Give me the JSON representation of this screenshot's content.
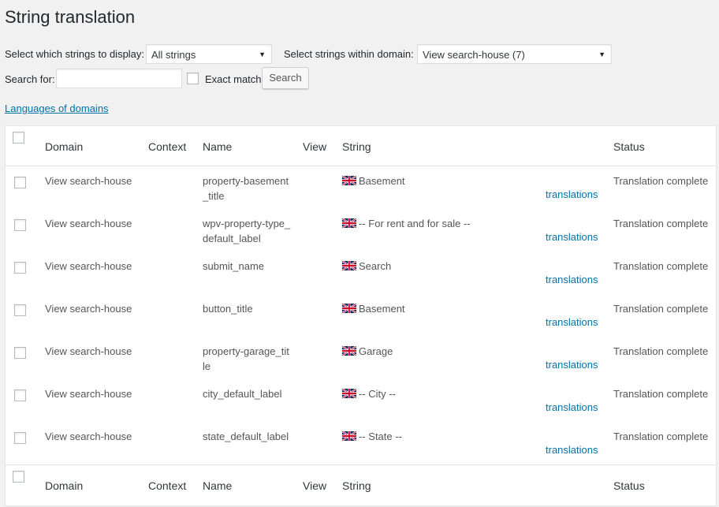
{
  "page": {
    "title": "String translation"
  },
  "filters": {
    "display_label": "Select which strings to display:",
    "display_value": "All strings",
    "domain_label": "Select strings within domain:",
    "domain_value": "View search-house (7)",
    "search_label": "Search for:",
    "search_value": "",
    "exact_match_label": "Exact match",
    "exact_match_checked": false,
    "search_button": "Search"
  },
  "languages_link": "Languages of domains",
  "table": {
    "columns": {
      "domain": "Domain",
      "context": "Context",
      "name": "Name",
      "view": "View",
      "string": "String",
      "status": "Status"
    },
    "rows": [
      {
        "domain": "View search-house",
        "context": "",
        "name": "property-basement_title",
        "view": "",
        "string": "Basement",
        "translations_link": "translations",
        "status": "Translation complete"
      },
      {
        "domain": "View search-house",
        "context": "",
        "name": "wpv-property-type_default_label",
        "view": "",
        "string": "-- For rent and for sale --",
        "translations_link": "translations",
        "status": "Translation complete"
      },
      {
        "domain": "View search-house",
        "context": "",
        "name": "submit_name",
        "view": "",
        "string": "Search",
        "translations_link": "translations",
        "status": "Translation complete"
      },
      {
        "domain": "View search-house",
        "context": "",
        "name": "button_title",
        "view": "",
        "string": "Basement",
        "translations_link": "translations",
        "status": "Translation complete"
      },
      {
        "domain": "View search-house",
        "context": "",
        "name": "property-garage_title",
        "view": "",
        "string": "Garage",
        "translations_link": "translations",
        "status": "Translation complete"
      },
      {
        "domain": "View search-house",
        "context": "",
        "name": "city_default_label",
        "view": "",
        "string": "-- City --",
        "translations_link": "translations",
        "status": "Translation complete"
      },
      {
        "domain": "View search-house",
        "context": "",
        "name": "state_default_label",
        "view": "",
        "string": "-- State --",
        "translations_link": "translations",
        "status": "Translation complete"
      }
    ]
  },
  "icons": {
    "flag": "uk-flag-icon",
    "dropdown": "chevron-down-icon"
  },
  "colors": {
    "link": "#0073aa",
    "background": "#f1f1f1",
    "title": "#23282d"
  }
}
